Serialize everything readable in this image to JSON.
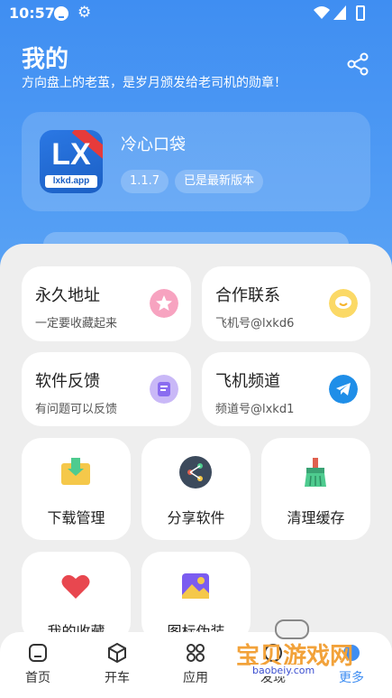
{
  "status_bar": {
    "time": "10:57"
  },
  "header": {
    "title": "我的",
    "subtitle": "方向盘上的老茧，是岁月颁发给老司机的勋章！"
  },
  "app_card": {
    "name": "冷心口袋",
    "logo_text": "LX",
    "logo_domain": "lxkd.app",
    "version": "1.1.7",
    "update_status": "已是最新版本"
  },
  "links": [
    {
      "title": "永久地址",
      "desc": "一定要收藏起来",
      "color": "#f06a9a"
    },
    {
      "title": "合作联系",
      "desc": "飞机号@lxkd6",
      "color": "#f5c23a"
    },
    {
      "title": "软件反馈",
      "desc": "有问题可以反馈",
      "color": "#9b7cf0"
    },
    {
      "title": "飞机频道",
      "desc": "频道号@lxkd1",
      "color": "#1f8ee8"
    }
  ],
  "tools": [
    {
      "label": "下载管理"
    },
    {
      "label": "分享软件"
    },
    {
      "label": "清理缓存"
    },
    {
      "label": "我的收藏"
    },
    {
      "label": "图标伪装"
    }
  ],
  "bottom_nav": [
    {
      "label": "首页"
    },
    {
      "label": "开车"
    },
    {
      "label": "应用"
    },
    {
      "label": "发现"
    },
    {
      "label": "更多"
    }
  ],
  "watermark": {
    "text": "宝贝游戏网",
    "domain": "baobeiy.com"
  },
  "colors": {
    "accent": "#3f8ef2",
    "sheet": "#eeeeee"
  }
}
